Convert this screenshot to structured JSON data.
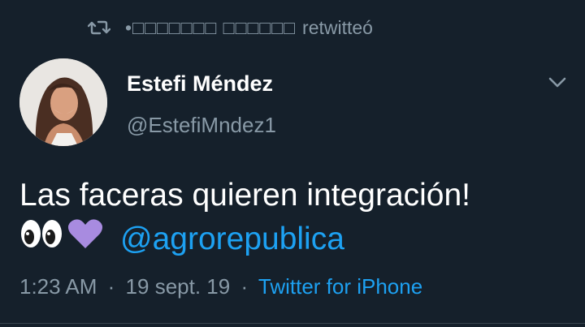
{
  "retweet": {
    "icon": "retweet-icon",
    "name": "•□□□□□□□ □□□□□□",
    "label": "retwitteó"
  },
  "tweet": {
    "display_name": "Estefi Méndez",
    "handle": "@EstefiMndez1",
    "text": "Las faceras quieren integración!",
    "emojis": [
      "eyes-emoji",
      "purple-heart-emoji"
    ],
    "mention": "@agrorepublica",
    "time": "1:23 AM",
    "date": "19 sept. 19",
    "source": "Twitter for iPhone",
    "separator": "·"
  },
  "colors": {
    "background": "#15202b",
    "secondary_text": "#8899a6",
    "link": "#1da1f2",
    "primary_text": "#ffffff"
  }
}
